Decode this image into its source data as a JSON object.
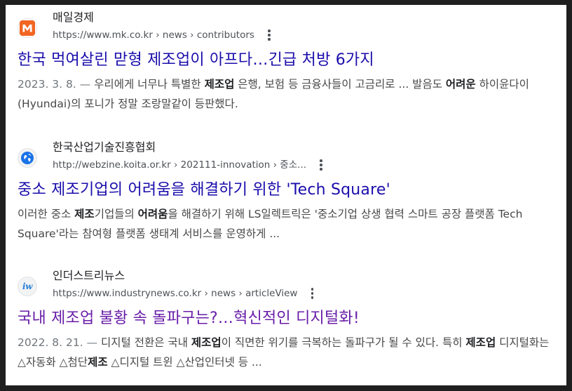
{
  "results": [
    {
      "site_name": "매일경제",
      "url": "https://www.mk.co.kr › news › contributors",
      "favicon": "mk-logo-icon",
      "title": "한국 먹여살린 맏형 제조업이 아프다…긴급 처방 6가지",
      "snippet_date": "2023. 3. 8. — ",
      "snippet_parts": [
        "우리에게 너무나 특별한 ",
        "제조업",
        " 은행, 보험 등 금융사들이 고금리로 ... 발음도 ",
        "어려운",
        " 하이윤다이(Hyundai)의 포니가 정말 조랑말같이 등판했다."
      ]
    },
    {
      "site_name": "한국산업기술진흥협회",
      "url": "http://webzine.koita.or.kr › 202111-innovation › 중소...",
      "favicon": "globe-icon",
      "title": "중소 제조기업의 어려움을 해결하기 위한 'Tech Square'",
      "snippet_date": "",
      "snippet_parts": [
        "이러한 중소 ",
        "제조",
        "기업들의 ",
        "어려움",
        "을 해결하기 위해 LS일렉트릭은 '중소기업 상생 협력 스마트 공장 플랫폼 Tech Square'라는 참여형 플랫폼 생태계 서비스를 운영하게 ..."
      ]
    },
    {
      "site_name": "인더스트리뉴스",
      "url": "https://www.industrynews.co.kr › news › articleView",
      "favicon": "iw-logo-icon",
      "favicon_text": "iw",
      "title": "국내 제조업 불황 속 돌파구는?…혁신적인 디지털화!",
      "snippet_date": "2022. 8. 21. — ",
      "snippet_parts": [
        "디지털 전환은 국내 ",
        "제조업",
        "이 직면한 위기를 극복하는 돌파구가 될 수 있다. 특히 ",
        "제조업",
        " 디지털화는 △자동화 △첨단",
        "제조",
        " △디지털 트윈 △산업인터넷 등 ..."
      ]
    }
  ],
  "colors": {
    "link": "#1a0dab",
    "visited": "#681da8",
    "mk_orange": "#f26522",
    "globe_blue": "#1a73e8",
    "iw_blue": "#2a7fd4"
  }
}
